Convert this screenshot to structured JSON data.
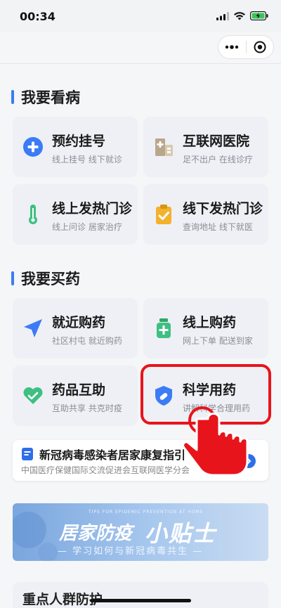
{
  "status_bar": {
    "time": "00:34"
  },
  "sections": {
    "see_doctor": {
      "title": "我要看病"
    },
    "buy_medicine": {
      "title": "我要买药"
    }
  },
  "cards": [
    {
      "title": "预约挂号",
      "subtitle": "线上挂号 线下就诊",
      "icon": "plus-circle-icon"
    },
    {
      "title": "互联网医院",
      "subtitle": "足不出户 在线诊疗",
      "icon": "hospital-building-icon"
    },
    {
      "title": "线上发热门诊",
      "subtitle": "线上问诊 居家治疗",
      "icon": "thermometer-icon"
    },
    {
      "title": "线下发热门诊",
      "subtitle": "查询地址 线下就医",
      "icon": "clipboard-check-icon"
    },
    {
      "title": "就近购药",
      "subtitle": "社区村屯 就近购药",
      "icon": "location-arrow-icon"
    },
    {
      "title": "线上购药",
      "subtitle": "网上下单 配送到家",
      "icon": "medicine-bottle-icon"
    },
    {
      "title": "药品互助",
      "subtitle": "互助共享 共克时疫",
      "icon": "heart-hands-icon"
    },
    {
      "title": "科学用药",
      "subtitle": "讲解科学合理用药",
      "icon": "shield-pill-icon"
    }
  ],
  "notice": {
    "title": "新冠病毒感染者居家康复指引",
    "subtitle": "中国医疗保健国际交流促进会互联网医学分会"
  },
  "banner": {
    "tips": "TIPS FOR EPIDEMIC PREVENTION AT HOME",
    "title_left": "居家防疫",
    "title_right": "小贴士",
    "slogan": "— 学习如何与新冠病毒共生 —"
  },
  "bottom_section": {
    "title": "重点人群防护"
  },
  "colors": {
    "accent": "#3b7cf6",
    "highlight": "#e8141c"
  }
}
